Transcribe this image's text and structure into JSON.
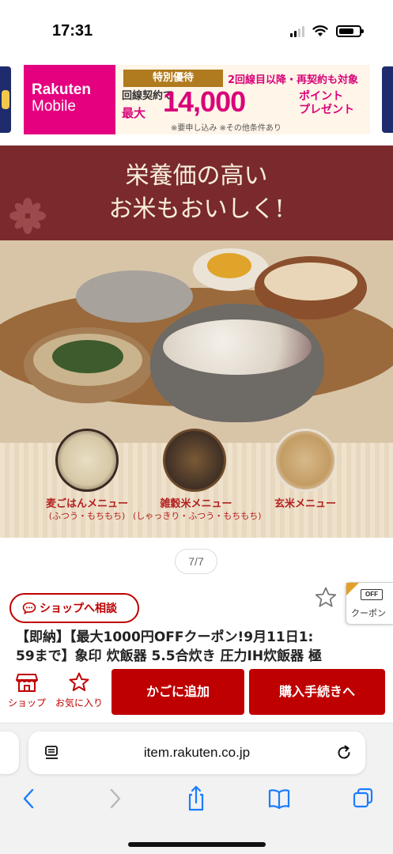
{
  "status_bar": {
    "time": "17:31"
  },
  "banner": {
    "brand_line1": "Rakuten",
    "brand_line2": "Mobile",
    "special_badge": "特別優待",
    "second_line": "2回線目以降・再契約も対象",
    "contract": "回線契約で",
    "max": "最大",
    "amount": "14,000",
    "point_line1": "ポイント",
    "point_line2": "プレゼント",
    "note": "※要申し込み ※その他条件あり",
    "brand_color": "#e4007f"
  },
  "hero": {
    "headline_line1": "栄養価の高い",
    "headline_line2": "お米もおいしく!",
    "menus": [
      {
        "label": "麦ごはんメニュー",
        "sub": "(ふつう・もちもち)"
      },
      {
        "label": "雑穀米メニュー",
        "sub": "(しゃっきり・ふつう・もちもち)"
      },
      {
        "label": "玄米メニュー",
        "sub": ""
      }
    ]
  },
  "gallery": {
    "counter": "7/7"
  },
  "product": {
    "consult_label": "ショップへ相談",
    "coupon_badge": "OFF",
    "coupon_label": "クーポン",
    "title_line1": "【即納】【最大1000円OFFクーポン!9月11日1:",
    "title_line2": "59まで】象印 炊飯器 5.5合炊き 圧力IH炊飯器 極"
  },
  "actions": {
    "shop_label": "ショップ",
    "favorite_label": "お気に入り",
    "cart_label": "かごに追加",
    "checkout_label": "購入手続きへ",
    "accent_color": "#bf0000"
  },
  "browser": {
    "url": "item.rakuten.co.jp"
  }
}
